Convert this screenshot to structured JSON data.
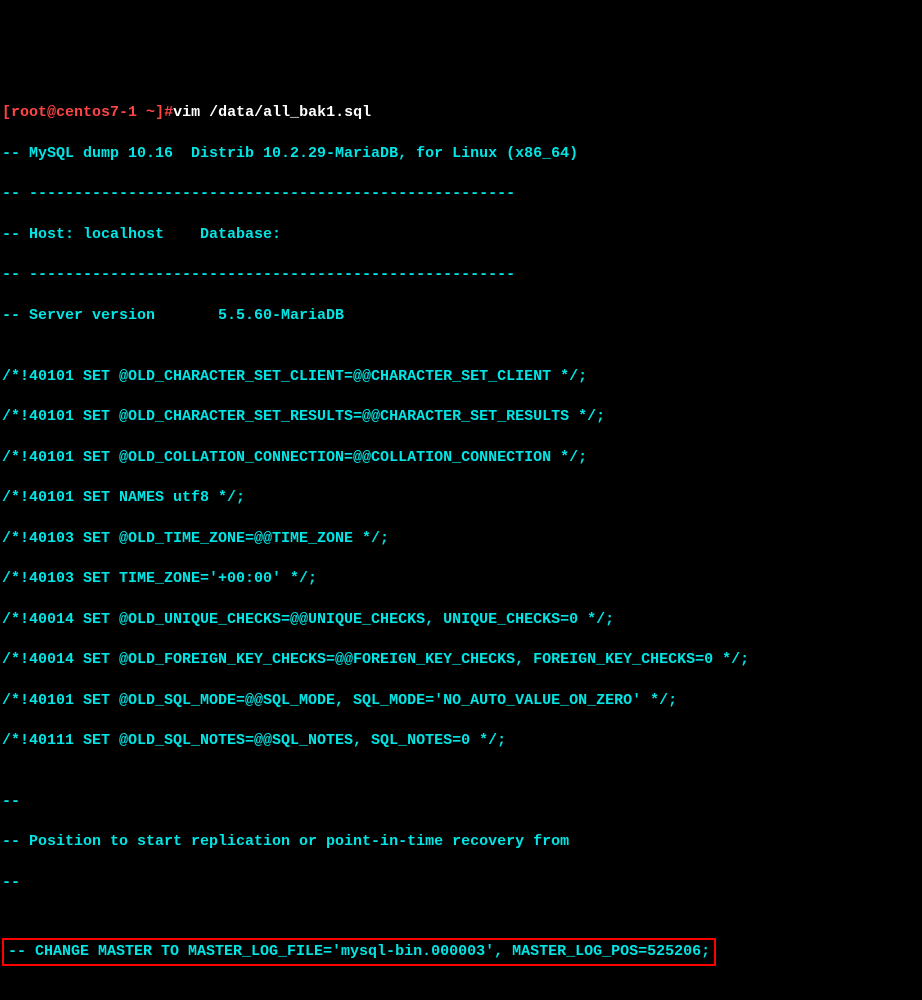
{
  "prompt": {
    "user_host": "[root@centos7-1",
    "tilde": "~",
    "marker": "]#",
    "command": "vim /data/all_bak1.sql"
  },
  "lines": {
    "l1": "-- MySQL dump 10.16  Distrib 10.2.29-MariaDB, for Linux (x86_64)",
    "l2": "-- ------------------------------------------------------",
    "l3": "-- Host: localhost    Database:",
    "l4": "-- ------------------------------------------------------",
    "l5": "-- Server version       5.5.60-MariaDB",
    "l6": "",
    "l7": "/*!40101 SET @OLD_CHARACTER_SET_CLIENT=@@CHARACTER_SET_CLIENT */;",
    "l8": "/*!40101 SET @OLD_CHARACTER_SET_RESULTS=@@CHARACTER_SET_RESULTS */;",
    "l9": "/*!40101 SET @OLD_COLLATION_CONNECTION=@@COLLATION_CONNECTION */;",
    "l10": "/*!40101 SET NAMES utf8 */;",
    "l11": "/*!40103 SET @OLD_TIME_ZONE=@@TIME_ZONE */;",
    "l12": "/*!40103 SET TIME_ZONE='+00:00' */;",
    "l13": "/*!40014 SET @OLD_UNIQUE_CHECKS=@@UNIQUE_CHECKS, UNIQUE_CHECKS=0 */;",
    "l14": "/*!40014 SET @OLD_FOREIGN_KEY_CHECKS=@@FOREIGN_KEY_CHECKS, FOREIGN_KEY_CHECKS=0 */;",
    "l15": "/*!40101 SET @OLD_SQL_MODE=@@SQL_MODE, SQL_MODE='NO_AUTO_VALUE_ON_ZERO' */;",
    "l16": "/*!40111 SET @OLD_SQL_NOTES=@@SQL_NOTES, SQL_NOTES=0 */;",
    "l17": "",
    "l18": "--",
    "l19": "-- Position to start replication or point-in-time recovery from",
    "l20": "--",
    "l21": "",
    "l22": "-- CHANGE MASTER TO MASTER_LOG_FILE='mysql-bin.000003', MASTER_LOG_POS=525206;"
  }
}
